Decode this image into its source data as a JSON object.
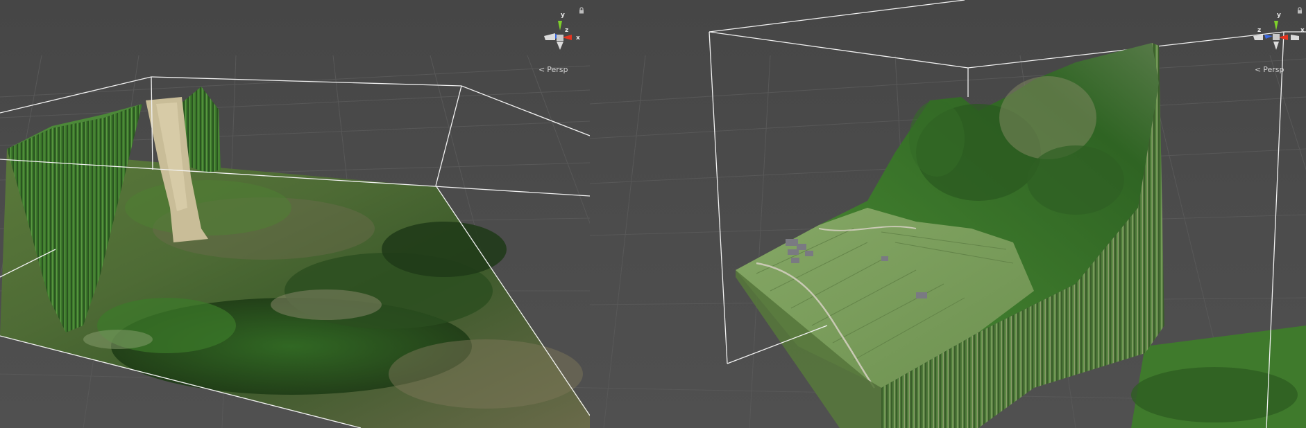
{
  "viewports": [
    {
      "id": "left",
      "gizmo": {
        "axis_y": "y",
        "axis_z": "z",
        "axis_x": "x"
      },
      "projection_label": "Persp",
      "lock_icon": "lock-icon"
    },
    {
      "id": "right",
      "gizmo": {
        "axis_y": "y",
        "axis_z": "z",
        "axis_x": "x"
      },
      "projection_label": "Persp",
      "lock_icon": "lock-icon"
    }
  ],
  "colors": {
    "background": "#454545",
    "grid": "#5a5a5a",
    "bounds_wire": "#ffffff",
    "axis_x": "#e5341f",
    "axis_y": "#7fd12a",
    "axis_z": "#3a68e3",
    "terrain_green": "#3f7a2e",
    "terrain_dark": "#24461c",
    "terrain_rock": "#8a8268"
  },
  "icons": [
    "scene-gizmo-icon",
    "lock-icon",
    "persp-toggle-icon"
  ]
}
